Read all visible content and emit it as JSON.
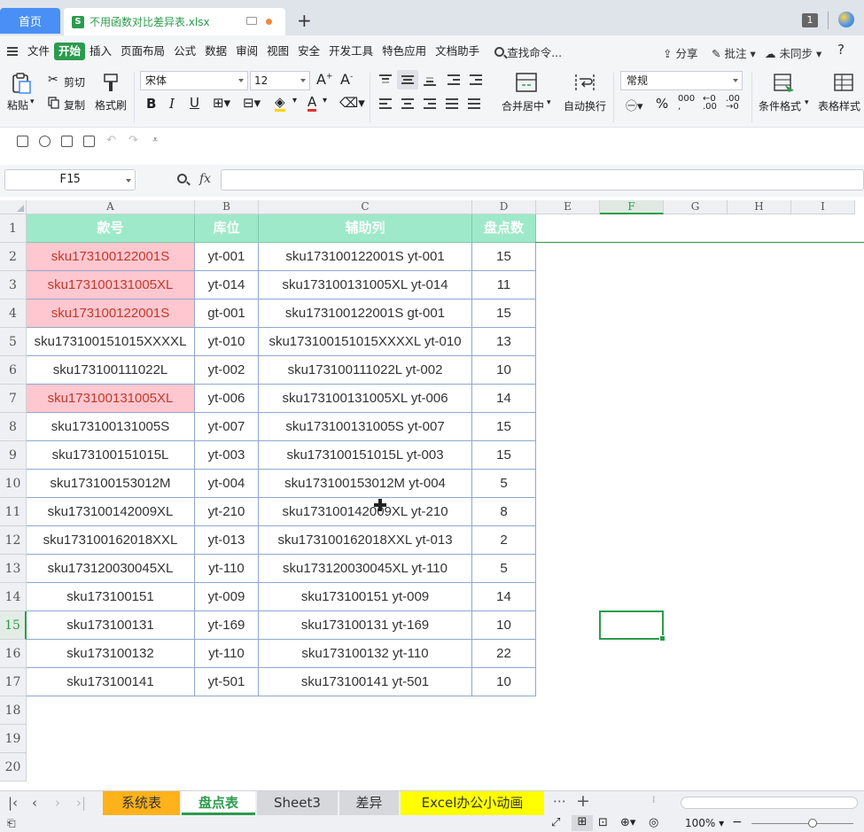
{
  "titlebar": {
    "home_tab": "首页",
    "doc_tab": "不用函数对比差异表.xlsx",
    "window_count": "1"
  },
  "menu": {
    "items": [
      "文件",
      "开始",
      "插入",
      "页面布局",
      "公式",
      "数据",
      "审阅",
      "视图",
      "安全",
      "开发工具",
      "特色应用",
      "文档助手"
    ],
    "active": "开始",
    "search": "查找命令...",
    "share": "分享",
    "comment": "批注",
    "sync": "未同步",
    "help": "?"
  },
  "ribbon": {
    "paste": "粘贴",
    "cut": "剪切",
    "copy": "复制",
    "format_painter": "格式刷",
    "font_name": "宋体",
    "font_size": "12",
    "merge_center": "合并居中",
    "wrap_text": "自动换行",
    "number_format": "常规",
    "conditional_format": "条件格式",
    "table_style": "表格样式"
  },
  "formula_bar": {
    "name_box": "F15",
    "fx": "fx",
    "formula": ""
  },
  "grid": {
    "columns": [
      "A",
      "B",
      "C",
      "D",
      "E",
      "F",
      "G",
      "H",
      "I"
    ],
    "selected_column": "F",
    "selected_row": 15,
    "row_numbers": [
      "1",
      "2",
      "3",
      "4",
      "5",
      "6",
      "7",
      "8",
      "9",
      "10",
      "11",
      "12",
      "13",
      "14",
      "15",
      "16",
      "17",
      "18",
      "19",
      "20"
    ],
    "headers": [
      "款号",
      "库位",
      "辅助列",
      "盘点数"
    ],
    "rows": [
      {
        "a": "sku173100122001S",
        "b": "yt-001",
        "c": "sku173100122001S yt-001",
        "d": "15",
        "highlight": true
      },
      {
        "a": "sku173100131005XL",
        "b": "yt-014",
        "c": "sku173100131005XL yt-014",
        "d": "11",
        "highlight": true
      },
      {
        "a": "sku173100122001S",
        "b": "gt-001",
        "c": "sku173100122001S gt-001",
        "d": "15",
        "highlight": true
      },
      {
        "a": "sku173100151015XXXXL",
        "b": "yt-010",
        "c": "sku173100151015XXXXL yt-010",
        "d": "13",
        "highlight": false
      },
      {
        "a": "sku173100111022L",
        "b": "yt-002",
        "c": "sku173100111022L yt-002",
        "d": "10",
        "highlight": false
      },
      {
        "a": "sku173100131005XL",
        "b": "yt-006",
        "c": "sku173100131005XL yt-006",
        "d": "14",
        "highlight": true
      },
      {
        "a": "sku173100131005S",
        "b": "yt-007",
        "c": "sku173100131005S yt-007",
        "d": "15",
        "highlight": false
      },
      {
        "a": "sku173100151015L",
        "b": "yt-003",
        "c": "sku173100151015L yt-003",
        "d": "15",
        "highlight": false
      },
      {
        "a": "sku173100153012M",
        "b": "yt-004",
        "c": "sku173100153012M yt-004",
        "d": "5",
        "highlight": false
      },
      {
        "a": "sku173100142009XL",
        "b": "yt-210",
        "c": "sku173100142009XL yt-210",
        "d": "8",
        "highlight": false
      },
      {
        "a": "sku173100162018XXL",
        "b": "yt-013",
        "c": "sku173100162018XXL yt-013",
        "d": "2",
        "highlight": false
      },
      {
        "a": "sku173120030045XL",
        "b": "yt-110",
        "c": "sku173120030045XL yt-110",
        "d": "5",
        "highlight": false
      },
      {
        "a": "sku173100151",
        "b": "yt-009",
        "c": "sku173100151 yt-009",
        "d": "14",
        "highlight": false
      },
      {
        "a": "sku173100131",
        "b": "yt-169",
        "c": "sku173100131 yt-169",
        "d": "10",
        "highlight": false
      },
      {
        "a": "sku173100132",
        "b": "yt-110",
        "c": "sku173100132 yt-110",
        "d": "22",
        "highlight": false
      },
      {
        "a": "sku173100141",
        "b": "yt-501",
        "c": "sku173100141 yt-501",
        "d": "10",
        "highlight": false
      }
    ]
  },
  "sheet_tabs": [
    {
      "label": "系统表",
      "color": "#ffb21a",
      "active": false
    },
    {
      "label": "盘点表",
      "color": "#ffffff",
      "active": true
    },
    {
      "label": "Sheet3",
      "color": "#d6d8dc",
      "active": false
    },
    {
      "label": "差异",
      "color": "#d6d8dc",
      "active": false
    },
    {
      "label": "Excel办公小动画",
      "color": "#ffff00",
      "active": false
    }
  ],
  "status": {
    "zoom": "100%"
  },
  "colors": {
    "accent": "#2c9b4e",
    "header_fill": "#9ee9c9",
    "highlight_fill": "#ffc7cf",
    "highlight_text": "#c0392b"
  }
}
